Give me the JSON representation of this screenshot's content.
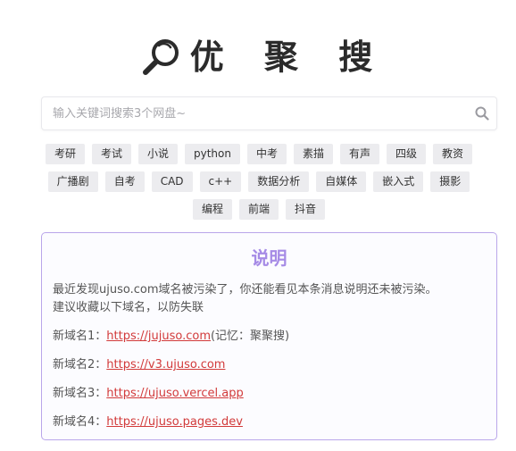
{
  "logo": {
    "text": "优 聚 搜",
    "icon": "magnifier-icon"
  },
  "search": {
    "placeholder": "输入关键词搜索3个网盘~",
    "value": "",
    "icon": "search-icon"
  },
  "tags": {
    "row1": [
      "考研",
      "考试",
      "小说",
      "python",
      "中考",
      "素描",
      "有声",
      "四级",
      "教资"
    ],
    "row2": [
      "广播剧",
      "自考",
      "CAD",
      "c++",
      "数据分析",
      "自媒体",
      "嵌入式",
      "摄影"
    ],
    "row3": [
      "编程",
      "前端",
      "抖音"
    ]
  },
  "notice": {
    "title": "说明",
    "line1": "最近发现ujuso.com域名被污染了，你还能看见本条消息说明还未被污染。",
    "line2": "建议收藏以下域名，以防失联",
    "domains": [
      {
        "label": "新域名1：",
        "url": "https://jujuso.com",
        "note": "(记忆：聚聚搜)"
      },
      {
        "label": "新域名2：",
        "url": "https://v3.ujuso.com",
        "note": ""
      },
      {
        "label": "新域名3：",
        "url": "https://ujuso.vercel.app",
        "note": ""
      },
      {
        "label": "新域名4：",
        "url": "https://ujuso.pages.dev",
        "note": ""
      }
    ]
  },
  "colors": {
    "accent": "#a68be6",
    "border": "#b9a6ea",
    "link": "#d23a3a",
    "tag_bg": "#ececef"
  }
}
